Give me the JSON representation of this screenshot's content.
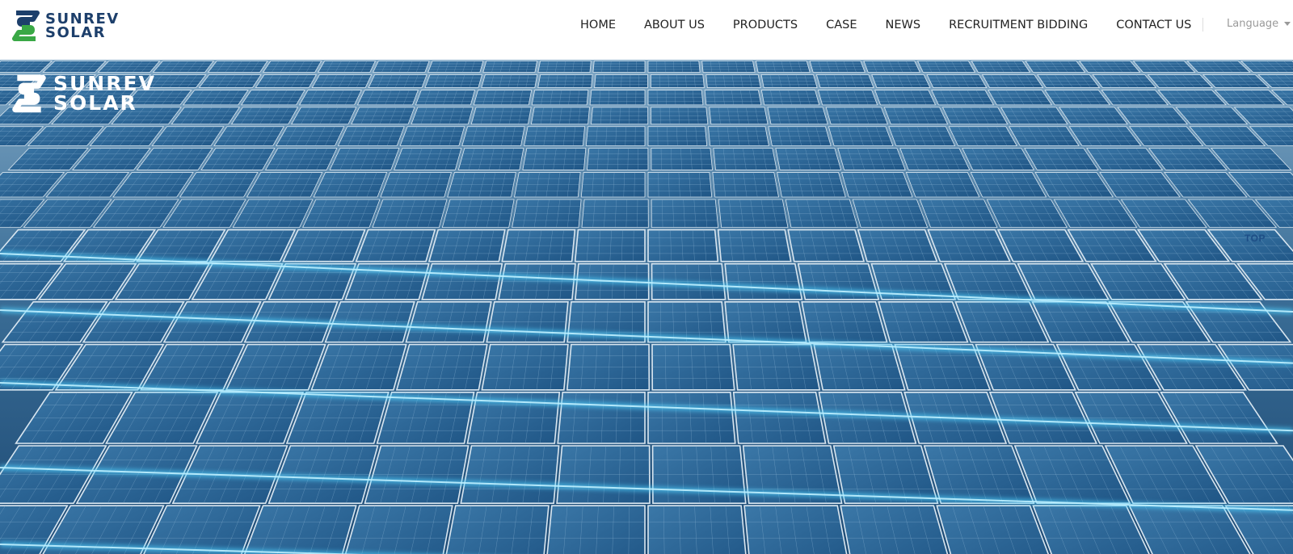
{
  "header": {
    "logo": {
      "line1": "SUNREV",
      "line2": "SOLAR"
    },
    "nav": [
      {
        "label": "HOME"
      },
      {
        "label": "ABOUT US"
      },
      {
        "label": "PRODUCTS"
      },
      {
        "label": "CASE"
      },
      {
        "label": "NEWS"
      },
      {
        "label": "RECRUITMENT BIDDING"
      },
      {
        "label": "CONTACT US"
      }
    ],
    "language": {
      "label": "Language",
      "icon": "chevron-down-icon"
    }
  },
  "hero": {
    "logo": {
      "line1": "SUNREV",
      "line2": "SOLAR"
    },
    "image": "solar-panel-field",
    "top_button": "TOP"
  },
  "colors": {
    "brand_navy": "#1d3f6b",
    "brand_green": "#39a845",
    "panel_blue": "#2d6796",
    "glow_cyan": "#4fd2ff",
    "nav_text": "#222222"
  }
}
